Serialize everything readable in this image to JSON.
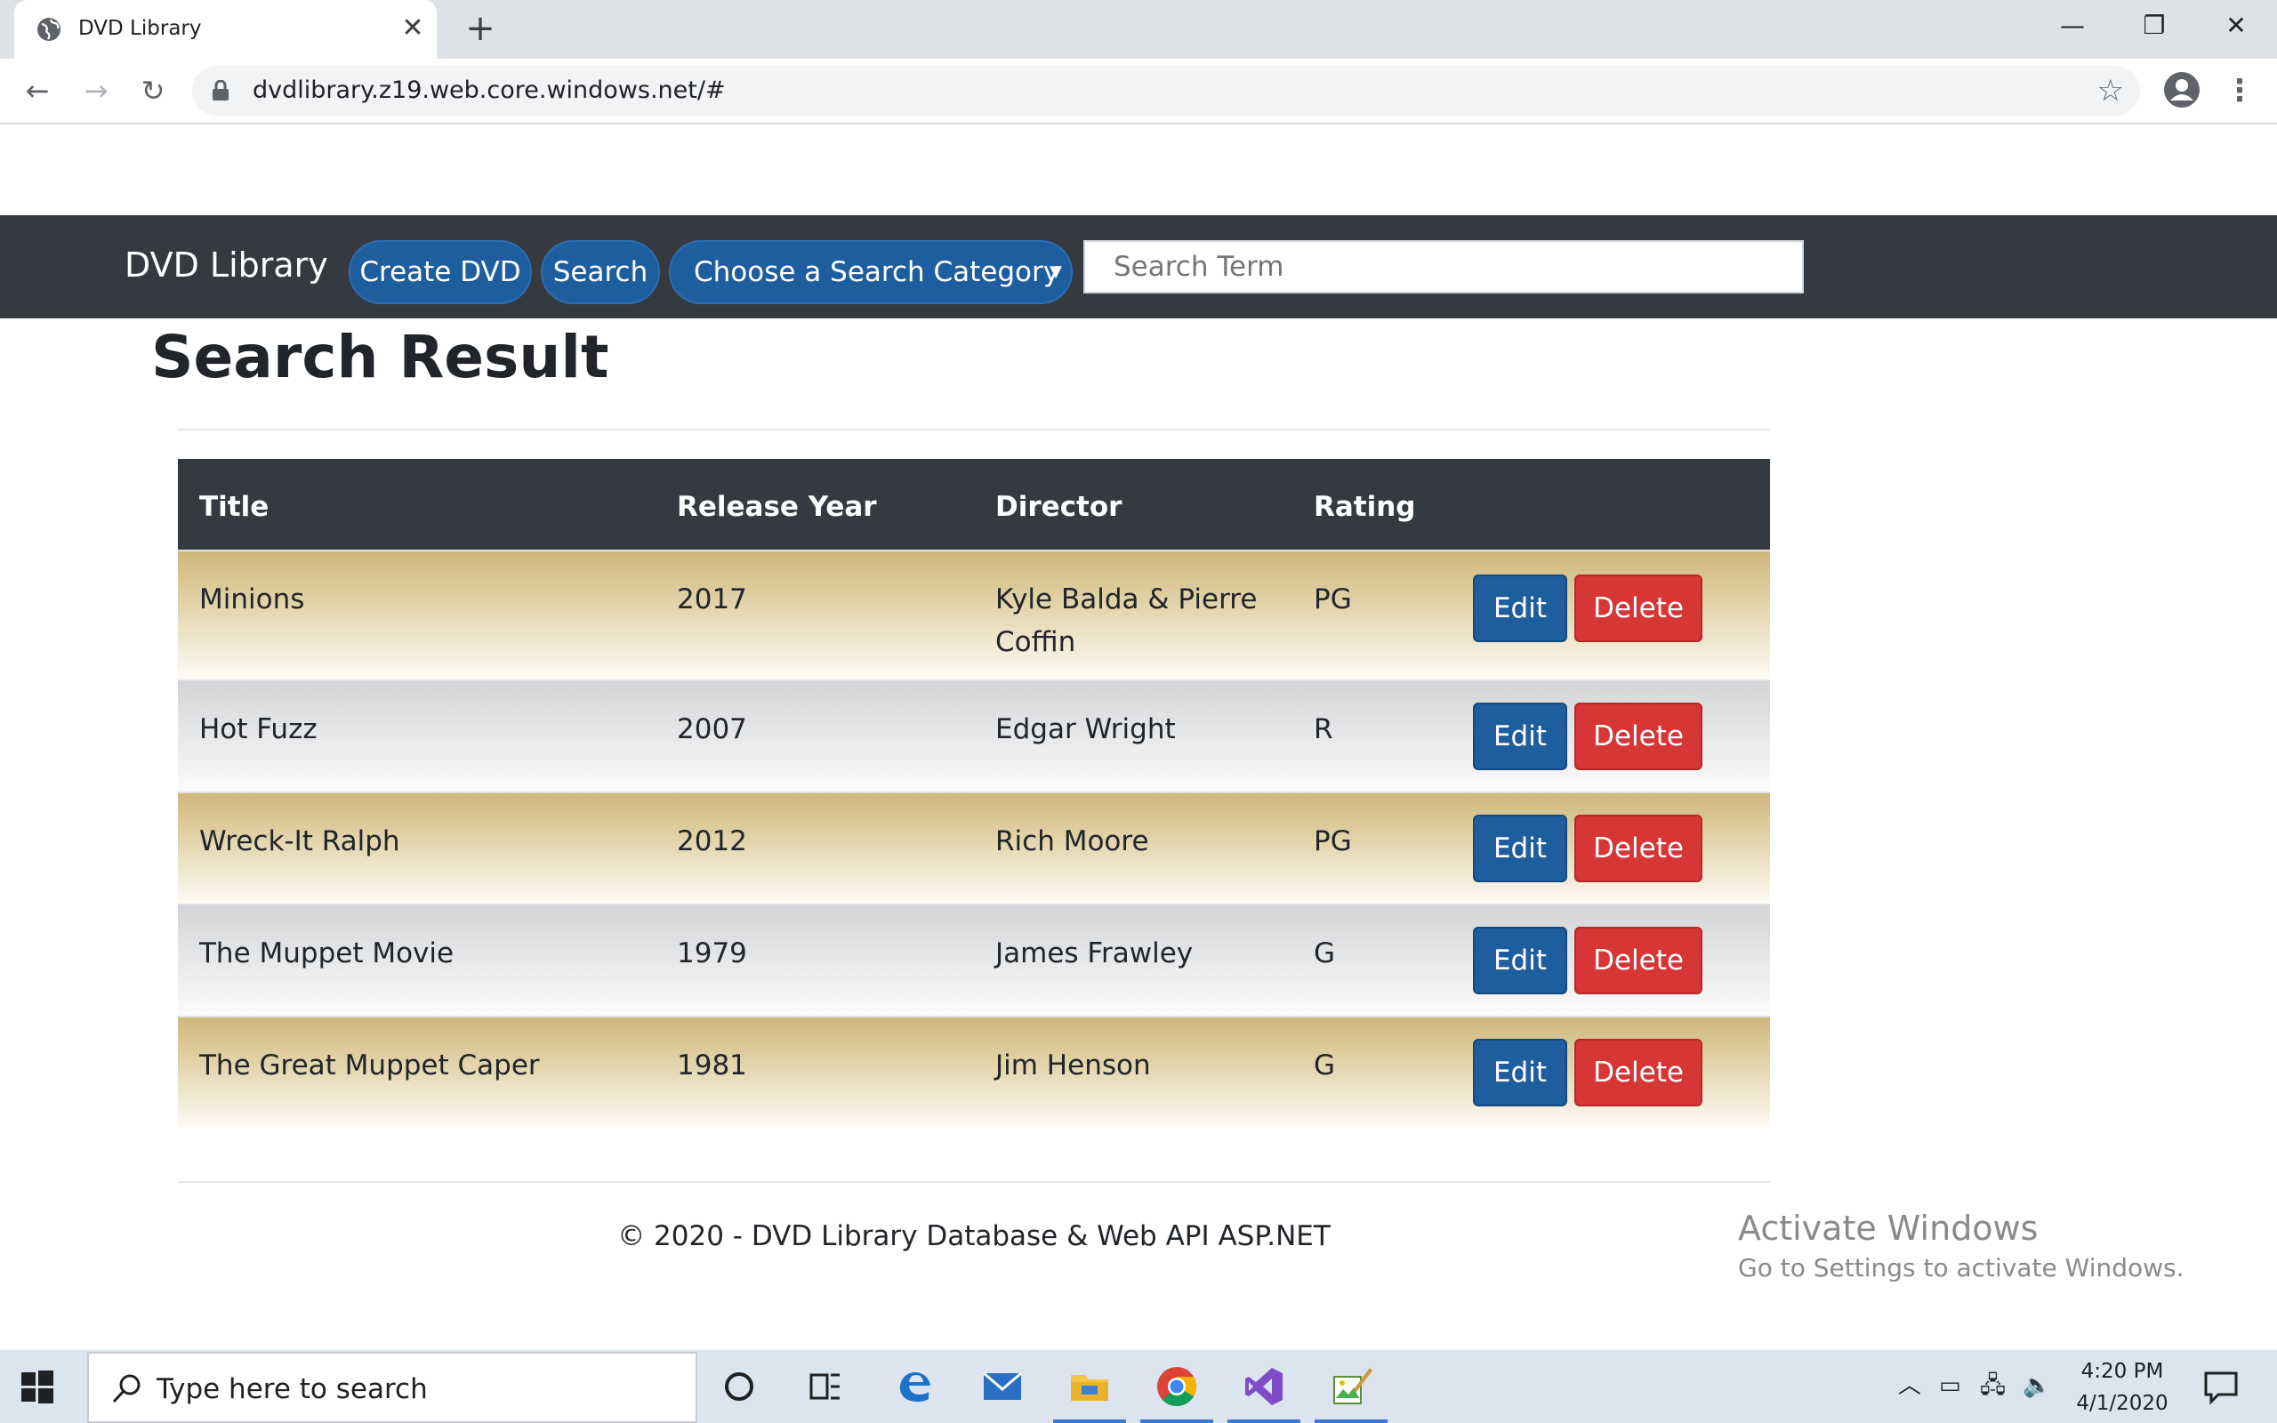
{
  "browser": {
    "tab_title": "DVD Library",
    "url": "dvdlibrary.z19.web.core.windows.net/#",
    "new_tab_icon": "plus-icon",
    "close_tab_icon": "close-icon"
  },
  "navbar": {
    "brand": "DVD Library",
    "create_label": "Create DVD",
    "search_label": "Search",
    "category_label": "Choose a Search Category",
    "search_placeholder": "Search Term"
  },
  "page": {
    "title": "Search Result"
  },
  "table": {
    "headers": [
      "Title",
      "Release Year",
      "Director",
      "Rating"
    ],
    "rows": [
      {
        "title": "Minions",
        "year": "2017",
        "director_line1": "Kyle Balda & Pierre",
        "director_line2": "Coffin",
        "rating": "PG",
        "edit": "Edit",
        "delete": "Delete"
      },
      {
        "title": "Hot Fuzz",
        "year": "2007",
        "director_line1": "Edgar Wright",
        "director_line2": "",
        "rating": "R",
        "edit": "Edit",
        "delete": "Delete"
      },
      {
        "title": "Wreck-It Ralph",
        "year": "2012",
        "director_line1": "Rich Moore",
        "director_line2": "",
        "rating": "PG",
        "edit": "Edit",
        "delete": "Delete"
      },
      {
        "title": "The Muppet Movie",
        "year": "1979",
        "director_line1": "James Frawley",
        "director_line2": "",
        "rating": "G",
        "edit": "Edit",
        "delete": "Delete"
      },
      {
        "title": "The Great Muppet Caper",
        "year": "1981",
        "director_line1": "Jim Henson",
        "director_line2": "",
        "rating": "G",
        "edit": "Edit",
        "delete": "Delete"
      }
    ]
  },
  "footer": {
    "text": "© 2020 - DVD Library Database & Web API ASP.NET"
  },
  "watermark": {
    "line1": "Activate Windows",
    "line2": "Go to Settings to activate Windows."
  },
  "taskbar": {
    "search_placeholder": "Type here to search",
    "time": "4:20 PM",
    "date": "4/1/2020"
  },
  "colors": {
    "navbar": "#343a40",
    "primary": "#1f5e9e",
    "danger": "#d73636",
    "row_gold": "#cfb77b",
    "row_silver": "#d3d4d6"
  }
}
